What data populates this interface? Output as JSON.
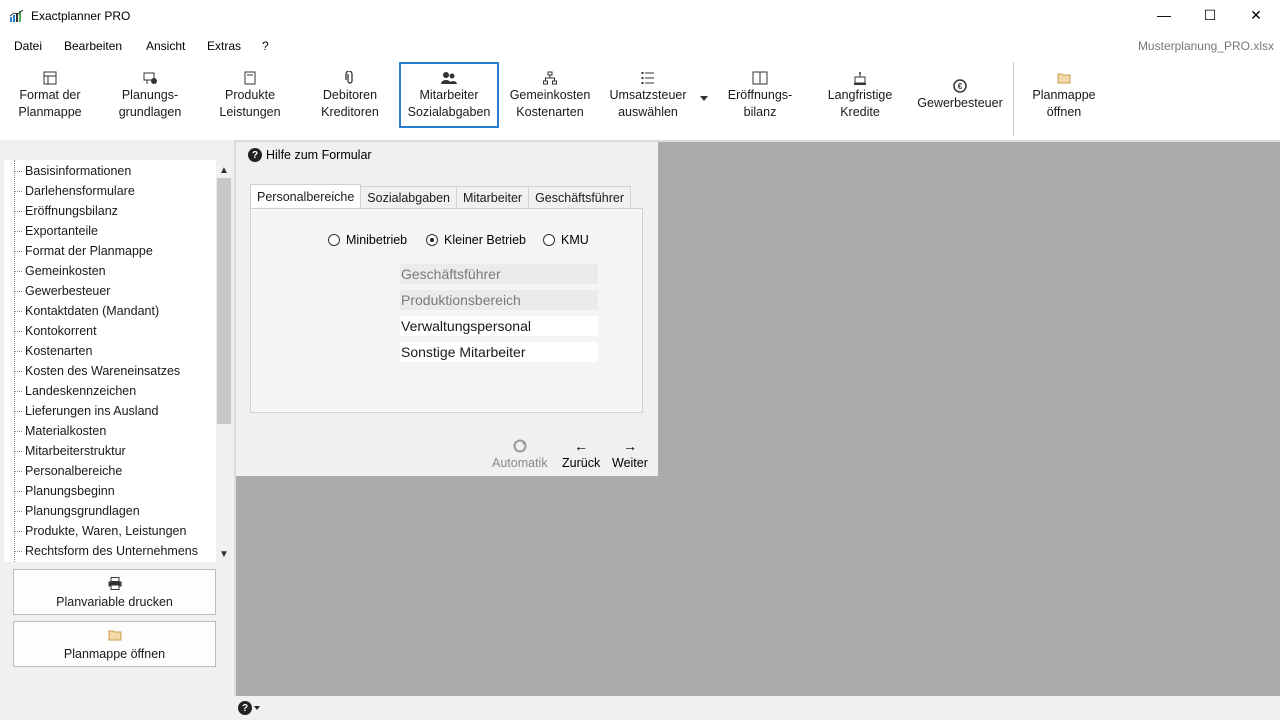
{
  "window": {
    "title": "Exactplanner PRO",
    "filename": "Musterplanung_PRO.xlsx",
    "controls": {
      "minimize": "—",
      "maximize": "☐",
      "close": "✕"
    }
  },
  "menu": [
    "Datei",
    "Bearbeiten",
    "Ansicht",
    "Extras",
    "?"
  ],
  "ribbon": [
    {
      "line1": "Format der",
      "line2": "Planmappe",
      "icon": "spreadsheet-icon"
    },
    {
      "line1": "Planungs-",
      "line2": "grundlagen",
      "icon": "settings-chart-icon"
    },
    {
      "line1": "Produkte",
      "line2": "Leistungen",
      "icon": "product-sheet-icon"
    },
    {
      "line1": "Debitoren",
      "line2": "Kreditoren",
      "icon": "paperclip-icon"
    },
    {
      "line1": "Mitarbeiter",
      "line2": "Sozialabgaben",
      "icon": "users-icon"
    },
    {
      "line1": "Gemeinkosten",
      "line2": "Kostenarten",
      "icon": "hierarchy-icon"
    },
    {
      "line1": "Umsatzsteuer",
      "line2": "auswählen",
      "icon": "list-icon"
    },
    {
      "line1": "Eröffnungs-",
      "line2": "bilanz",
      "icon": "book-icon"
    },
    {
      "line1": "Langfristige",
      "line2": "Kredite",
      "icon": "bank-icon"
    },
    {
      "line1": "Gewerbesteuer",
      "line2": "",
      "icon": "tax-icon"
    },
    {
      "line1": "Planmappe",
      "line2": "öffnen",
      "icon": "folder-icon"
    }
  ],
  "tree_items": [
    "Basisinformationen",
    "Darlehensformulare",
    "Eröffnungsbilanz",
    "Exportanteile",
    "Format der Planmappe",
    "Gemeinkosten",
    "Gewerbesteuer",
    "Kontaktdaten (Mandant)",
    "Kontokorrent",
    "Kostenarten",
    "Kosten des Wareneinsatzes",
    "Landeskennzeichen",
    "Lieferungen ins Ausland",
    "Materialkosten",
    "Mitarbeiterstruktur",
    "Personalbereiche",
    "Planungsbeginn",
    "Planungsgrundlagen",
    "Produkte, Waren, Leistungen",
    "Rechtsform des Unternehmens"
  ],
  "side_buttons": {
    "print": "Planvariable drucken",
    "open": "Planmappe öffnen"
  },
  "form": {
    "help_label": "Hilfe zum Formular",
    "tabs": [
      "Personalbereiche",
      "Sozialabgaben",
      "Mitarbeiter",
      "Geschäftsführer"
    ],
    "radios": [
      {
        "label": "Minibetrieb",
        "checked": false
      },
      {
        "label": "Kleiner Betrieb",
        "checked": true
      },
      {
        "label": "KMU",
        "checked": false
      }
    ],
    "fields": [
      {
        "value": "Geschäftsführer",
        "enabled": false
      },
      {
        "value": "Produktionsbereich",
        "enabled": false
      },
      {
        "value": "Verwaltungspersonal",
        "enabled": true
      },
      {
        "value": "Sonstige Mitarbeiter",
        "enabled": true
      }
    ],
    "nav": {
      "automatic": "Automatik",
      "back": "Zurück",
      "next": "Weiter"
    }
  },
  "status": {
    "help_glyph": "?"
  }
}
